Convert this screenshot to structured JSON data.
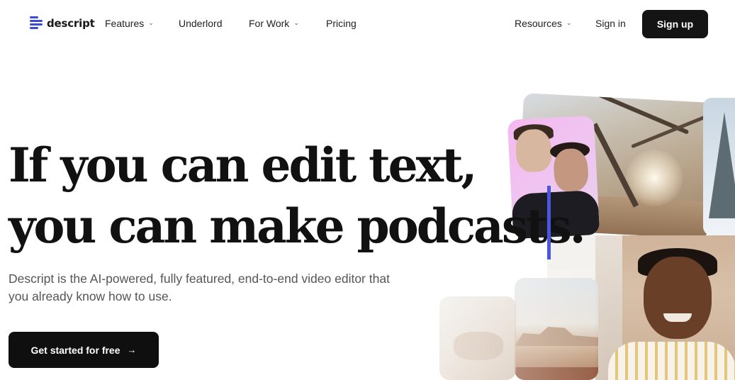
{
  "nav": {
    "brand": "descript",
    "items": [
      {
        "label": "Features",
        "has_dropdown": true
      },
      {
        "label": "Underlord",
        "has_dropdown": false
      },
      {
        "label": "For Work",
        "has_dropdown": true
      },
      {
        "label": "Pricing",
        "has_dropdown": false
      }
    ],
    "resources": {
      "label": "Resources",
      "has_dropdown": true
    },
    "signin": "Sign in",
    "signup": "Sign up"
  },
  "hero": {
    "headline_line1": "If you can edit text,",
    "headline_line2": "you can make podcasts.",
    "subtitle": "Descript is the AI-powered, fully featured, end-to-end video editor that you already know how to use.",
    "cta_label": "Get started for free",
    "cta_icon": "arrow-right-icon"
  },
  "collage": {
    "images": [
      "tree-scene",
      "snow-scene",
      "pink-podcast-scene",
      "smiling-portrait",
      "canyon-scene",
      "hands-scene"
    ]
  },
  "colors": {
    "accent": "#4a55e0",
    "button_dark": "#141414",
    "logo": "#3b4bd8"
  }
}
